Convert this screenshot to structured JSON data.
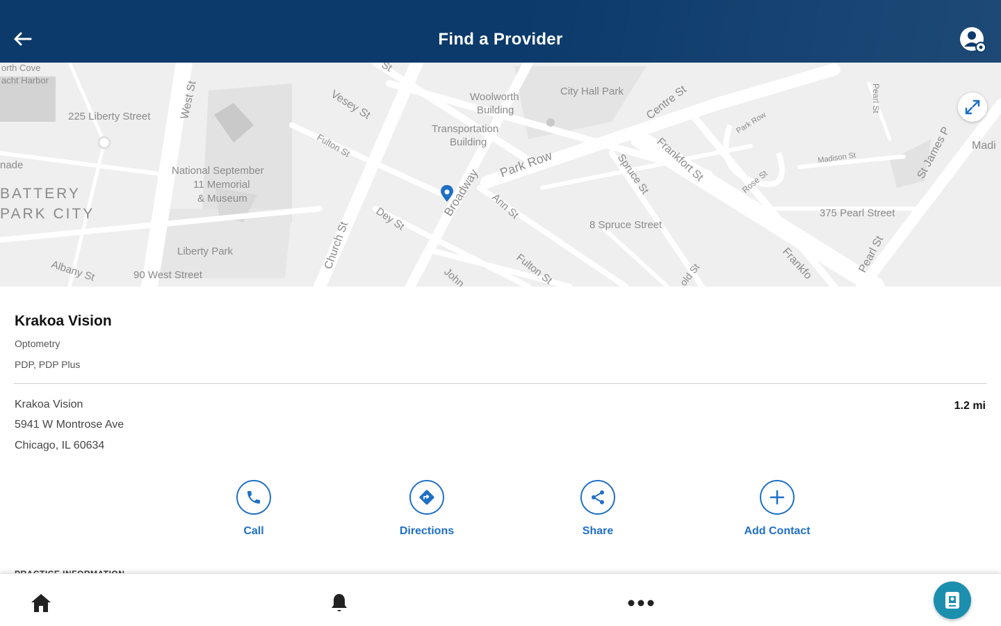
{
  "header": {
    "title": "Find a Provider"
  },
  "map": {
    "labels": {
      "north_cove": "orth Cove",
      "yacht_harbor": "acht Harbor",
      "liberty_225": "225 Liberty Street",
      "west_st": "West St",
      "vesey_st": "Vesey St",
      "woolworth": "Woolworth",
      "building": "Building",
      "city_hall_park": "City Hall Park",
      "centre_st": "Centre St",
      "pearl_st_top": "Pearl St",
      "park_row_small": "Park Row",
      "madi": "Madi",
      "fulton_st_upper": "Fulton St",
      "transportation": "Transportation",
      "building2": "Building",
      "frankfort_st": "Frankfort St",
      "madison_st": "Madison St",
      "st_james": "St James P",
      "nade": "nade",
      "battery": "BATTERY",
      "park_city": "PARK CITY",
      "national_sept": "National September",
      "eleven_memorial": "11 Memorial",
      "museum": "& Museum",
      "park_row": "Park Row",
      "broadway": "Broadway",
      "spruce_st": "Spruce St",
      "rose_st": "Rose St",
      "ann_st": "Ann St",
      "dey_st": "Dey St",
      "church_st": "Church St",
      "spruce_8": "8 Spruce Street",
      "pearl_375": "375 Pearl Street",
      "pearl_st": "Pearl St",
      "liberty_park": "Liberty Park",
      "albany_st": "Albany St",
      "west_90": "90 West Street",
      "fulton_st_lower": "Fulton St",
      "john": "John",
      "gold_st": "old St",
      "frankfo": "Frankfo",
      "st_top": "St"
    }
  },
  "provider": {
    "name": "Krakoa Vision",
    "specialty": "Optometry",
    "plans": "PDP, PDP Plus",
    "address_name": "Krakoa Vision",
    "street": "5941 W Montrose Ave",
    "city_line": "Chicago, IL 60634",
    "distance": "1.2 mi"
  },
  "actions": {
    "call": "Call",
    "directions": "Directions",
    "share": "Share",
    "add_contact": "Add Contact"
  },
  "section_peek": "PRACTICE INFORMATION",
  "colors": {
    "header": "#0b3a6b",
    "accent": "#1f6fc5",
    "id_card": "#1c8fae"
  },
  "icons": {
    "back": "arrow-left-icon",
    "account": "account-settings-icon",
    "expand": "expand-icon",
    "pin": "map-pin-icon",
    "home": "home-icon",
    "bell": "bell-icon",
    "more": "more-dots-icon",
    "id_card": "id-card-icon"
  }
}
